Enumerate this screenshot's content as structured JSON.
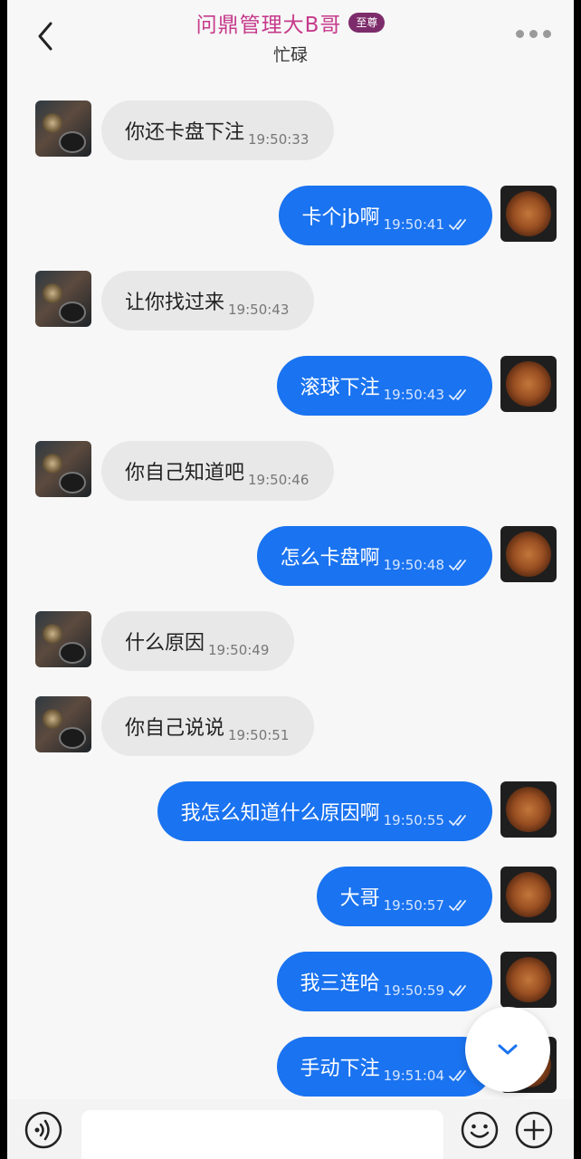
{
  "header": {
    "title": "问鼎管理大B哥",
    "badge": "至尊",
    "status": "忙碌"
  },
  "messages": [
    {
      "dir": "in",
      "text": "你还卡盘下注",
      "time": "19:50:33"
    },
    {
      "dir": "out",
      "text": "卡个jb啊",
      "time": "19:50:41"
    },
    {
      "dir": "in",
      "text": "让你找过来",
      "time": "19:50:43"
    },
    {
      "dir": "out",
      "text": "滚球下注",
      "time": "19:50:43"
    },
    {
      "dir": "in",
      "text": "你自己知道吧",
      "time": "19:50:46"
    },
    {
      "dir": "out",
      "text": "怎么卡盘啊",
      "time": "19:50:48"
    },
    {
      "dir": "in",
      "text": "什么原因",
      "time": "19:50:49"
    },
    {
      "dir": "in",
      "text": "你自己说说",
      "time": "19:50:51"
    },
    {
      "dir": "out",
      "text": "我怎么知道什么原因啊",
      "time": "19:50:55"
    },
    {
      "dir": "out",
      "text": "大哥",
      "time": "19:50:57"
    },
    {
      "dir": "out",
      "text": "我三连哈",
      "time": "19:50:59"
    },
    {
      "dir": "out",
      "text": "手动下注",
      "time": "19:51:04"
    }
  ],
  "composer": {
    "value": "",
    "placeholder": ""
  },
  "icons": {
    "back": "chevron-left-icon",
    "more": "more-dots-icon",
    "read": "double-check-icon",
    "scroll": "chevron-down-icon",
    "voice": "voice-icon",
    "emoji": "emoji-icon",
    "plus": "plus-icon"
  },
  "colors": {
    "outgoing_bubble": "#1a73f0",
    "incoming_bubble": "#e8e8e8",
    "title": "#c63a8b",
    "badge": "#7d2c6b"
  }
}
